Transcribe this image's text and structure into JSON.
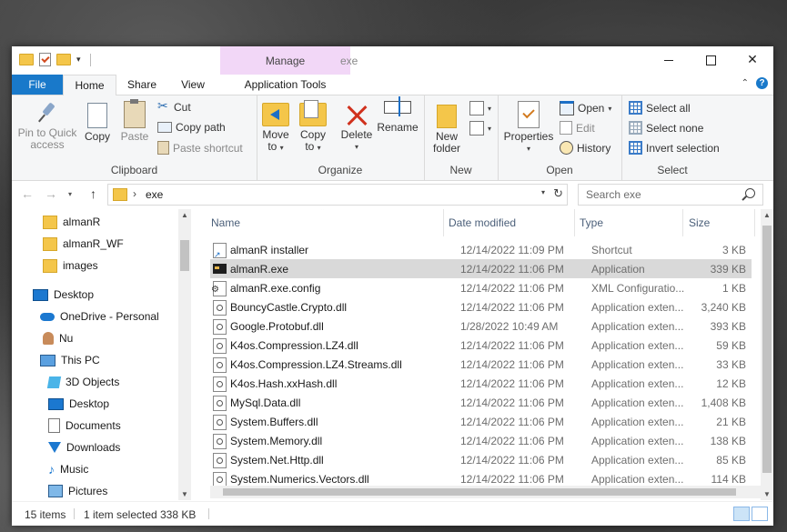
{
  "window": {
    "title": "exe",
    "context_tab_group": "Manage"
  },
  "tabs": {
    "file": "File",
    "home": "Home",
    "share": "Share",
    "view": "View",
    "app_tools": "Application Tools"
  },
  "ribbon": {
    "clipboard": {
      "label": "Clipboard",
      "pin_line1": "Pin to Quick",
      "pin_line2": "access",
      "copy": "Copy",
      "paste": "Paste",
      "cut": "Cut",
      "copy_path": "Copy path",
      "paste_shortcut": "Paste shortcut"
    },
    "organize": {
      "label": "Organize",
      "move_line1": "Move",
      "move_line2": "to",
      "copy_line1": "Copy",
      "copy_line2": "to",
      "delete": "Delete",
      "rename": "Rename"
    },
    "new": {
      "label": "New",
      "folder_line1": "New",
      "folder_line2": "folder"
    },
    "open": {
      "label": "Open",
      "properties": "Properties",
      "open": "Open",
      "edit": "Edit",
      "history": "History"
    },
    "select": {
      "label": "Select",
      "select_all": "Select all",
      "select_none": "Select none",
      "invert": "Invert selection"
    }
  },
  "address": {
    "path": "exe",
    "search_placeholder": "Search exe"
  },
  "nav": [
    {
      "label": "almanR",
      "icon": "folder-icon"
    },
    {
      "label": "almanR_WF",
      "icon": "folder-icon"
    },
    {
      "label": "images",
      "icon": "folder-icon"
    },
    {
      "label": "Desktop",
      "icon": "desktop-icon"
    },
    {
      "label": "OneDrive - Personal",
      "icon": "onedrive-icon"
    },
    {
      "label": "Nu",
      "icon": "user-icon"
    },
    {
      "label": "This PC",
      "icon": "this-pc-icon"
    },
    {
      "label": "3D Objects",
      "icon": "3d-objects-icon"
    },
    {
      "label": "Desktop",
      "icon": "desktop-icon"
    },
    {
      "label": "Documents",
      "icon": "documents-icon"
    },
    {
      "label": "Downloads",
      "icon": "downloads-icon"
    },
    {
      "label": "Music",
      "icon": "music-icon"
    },
    {
      "label": "Pictures",
      "icon": "pictures-icon"
    }
  ],
  "columns": {
    "name": "Name",
    "date": "Date modified",
    "type": "Type",
    "size": "Size"
  },
  "files": [
    {
      "name": "almanR installer",
      "date": "12/14/2022 11:09 PM",
      "type": "Shortcut",
      "size": "3 KB",
      "icon": "shortcut-icon"
    },
    {
      "name": "almanR.exe",
      "date": "12/14/2022 11:06 PM",
      "type": "Application",
      "size": "339 KB",
      "icon": "exe-icon",
      "selected": true
    },
    {
      "name": "almanR.exe.config",
      "date": "12/14/2022 11:06 PM",
      "type": "XML Configuratio...",
      "size": "1 KB",
      "icon": "config-icon"
    },
    {
      "name": "BouncyCastle.Crypto.dll",
      "date": "12/14/2022 11:06 PM",
      "type": "Application exten...",
      "size": "3,240 KB",
      "icon": "dll-icon"
    },
    {
      "name": "Google.Protobuf.dll",
      "date": "1/28/2022 10:49 AM",
      "type": "Application exten...",
      "size": "393 KB",
      "icon": "dll-icon"
    },
    {
      "name": "K4os.Compression.LZ4.dll",
      "date": "12/14/2022 11:06 PM",
      "type": "Application exten...",
      "size": "59 KB",
      "icon": "dll-icon"
    },
    {
      "name": "K4os.Compression.LZ4.Streams.dll",
      "date": "12/14/2022 11:06 PM",
      "type": "Application exten...",
      "size": "33 KB",
      "icon": "dll-icon"
    },
    {
      "name": "K4os.Hash.xxHash.dll",
      "date": "12/14/2022 11:06 PM",
      "type": "Application exten...",
      "size": "12 KB",
      "icon": "dll-icon"
    },
    {
      "name": "MySql.Data.dll",
      "date": "12/14/2022 11:06 PM",
      "type": "Application exten...",
      "size": "1,408 KB",
      "icon": "dll-icon"
    },
    {
      "name": "System.Buffers.dll",
      "date": "12/14/2022 11:06 PM",
      "type": "Application exten...",
      "size": "21 KB",
      "icon": "dll-icon"
    },
    {
      "name": "System.Memory.dll",
      "date": "12/14/2022 11:06 PM",
      "type": "Application exten...",
      "size": "138 KB",
      "icon": "dll-icon"
    },
    {
      "name": "System.Net.Http.dll",
      "date": "12/14/2022 11:06 PM",
      "type": "Application exten...",
      "size": "85 KB",
      "icon": "dll-icon"
    },
    {
      "name": "System.Numerics.Vectors.dll",
      "date": "12/14/2022 11:06 PM",
      "type": "Application exten...",
      "size": "114 KB",
      "icon": "dll-icon"
    }
  ],
  "status": {
    "items": "15 items",
    "selected": "1 item selected",
    "size": "338 KB"
  },
  "colors": {
    "accent": "#1979ca",
    "context_tab": "#f2d7f7",
    "selection": "#d9d9d9"
  }
}
